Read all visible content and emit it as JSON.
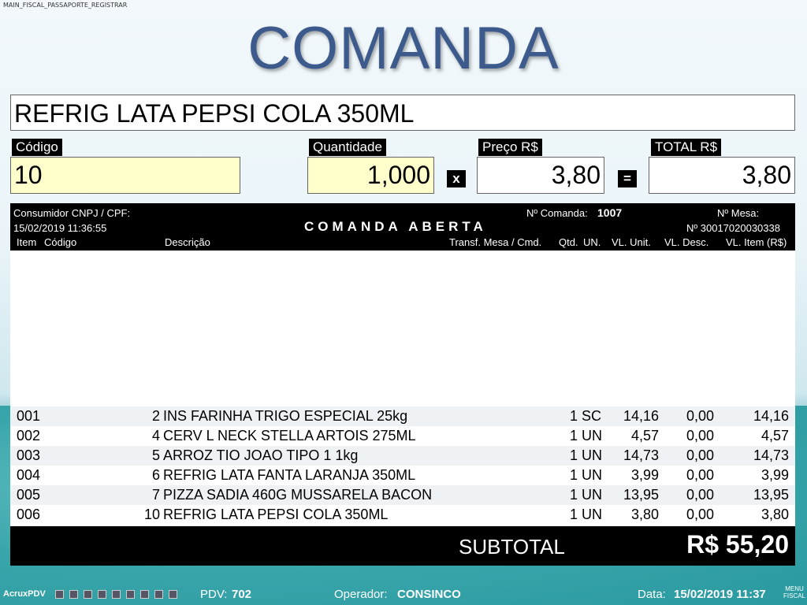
{
  "corner_text": "MAIN_FISCAL_PASSAPORTE_REGISTRAR",
  "title": "COMANDA",
  "product_name": "REFRIG LATA PEPSI COLA 350ML",
  "fields": {
    "codigo": {
      "label": "Código",
      "value": "10"
    },
    "quantidade": {
      "label": "Quantidade",
      "value": "1,000"
    },
    "preco": {
      "label": "Preço R$",
      "value": "3,80"
    },
    "total": {
      "label": "TOTAL R$",
      "value": "3,80"
    },
    "op_multiply": "x",
    "op_equals": "="
  },
  "grid_header": {
    "consumidor": "Consumidor CNPJ / CPF:",
    "datetime": "15/02/2019 11:36:55",
    "comanda_label": "Nº Comanda:",
    "comanda_number": "1007",
    "status": "COMANDA ABERTA",
    "mesa_label": "Nº Mesa:",
    "serial": "Nº 30017020030338",
    "columns": {
      "item": "Item",
      "codigo": "Código",
      "descricao": "Descrição",
      "transf": "Transf. Mesa / Cmd.",
      "qtd": "Qtd.",
      "un": "UN.",
      "vl_unit": "VL. Unit.",
      "vl_desc": "VL. Desc.",
      "vl_item": "VL. Item (R$)"
    }
  },
  "items": [
    {
      "item": "001",
      "codigo": "2",
      "descricao": "INS FARINHA TRIGO ESPECIAL 25kg",
      "qtd": "1",
      "un": "SC",
      "vl_unit": "14,16",
      "vl_desc": "0,00",
      "vl_item": "14,16"
    },
    {
      "item": "002",
      "codigo": "4",
      "descricao": "CERV L NECK STELLA ARTOIS 275ML",
      "qtd": "1",
      "un": "UN",
      "vl_unit": "4,57",
      "vl_desc": "0,00",
      "vl_item": "4,57"
    },
    {
      "item": "003",
      "codigo": "5",
      "descricao": "ARROZ TIO JOAO TIPO 1 1kg",
      "qtd": "1",
      "un": "UN",
      "vl_unit": "14,73",
      "vl_desc": "0,00",
      "vl_item": "14,73"
    },
    {
      "item": "004",
      "codigo": "6",
      "descricao": "REFRIG LATA FANTA LARANJA 350ML",
      "qtd": "1",
      "un": "UN",
      "vl_unit": "3,99",
      "vl_desc": "0,00",
      "vl_item": "3,99"
    },
    {
      "item": "005",
      "codigo": "7",
      "descricao": "PIZZA SADIA 460G MUSSARELA BACON",
      "qtd": "1",
      "un": "UN",
      "vl_unit": "13,95",
      "vl_desc": "0,00",
      "vl_item": "13,95"
    },
    {
      "item": "006",
      "codigo": "10",
      "descricao": "REFRIG LATA PEPSI COLA 350ML",
      "qtd": "1",
      "un": "UN",
      "vl_unit": "3,80",
      "vl_desc": "0,00",
      "vl_item": "3,80"
    }
  ],
  "subtotal": {
    "label": "SUBTOTAL",
    "value": "R$ 55,20"
  },
  "statusbar": {
    "app_name": "AcruxPDV",
    "pdv_label": "PDV:",
    "pdv_value": "702",
    "operador_label": "Operador:",
    "operador_value": "CONSINCO",
    "data_label": "Data:",
    "data_value": "15/02/2019 11:37",
    "menu_fiscal": "MENU FISCAL",
    "tray_icons": [
      "network-icon",
      "computer-icon",
      "printer-icon",
      "scale-icon",
      "keyboard-icon",
      "shield-icon",
      "drawer-icon",
      "card-reader-icon",
      "calculator-icon"
    ]
  }
}
